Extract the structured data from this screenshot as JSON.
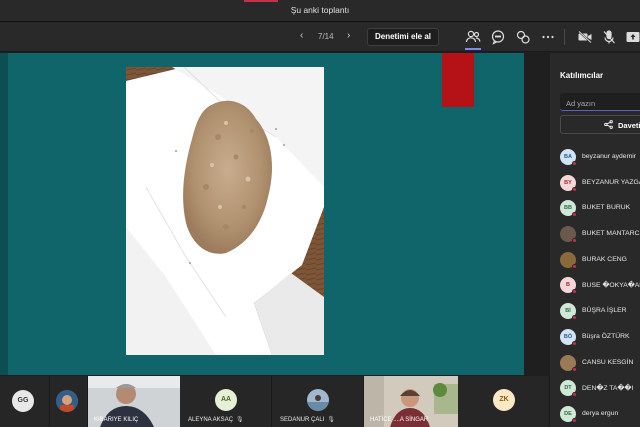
{
  "window": {
    "title": "Şu anki toplantı"
  },
  "toolbar": {
    "prev_icon": "chevron-left-icon",
    "page_indicator": "7/14",
    "next_icon": "chevron-right-icon",
    "take_control_label": "Denetimi ele al",
    "icons": [
      "participants-icon",
      "chat-icon",
      "reactions-icon",
      "more-icon",
      "camera-off-icon",
      "mic-off-icon",
      "share-icon"
    ]
  },
  "colors": {
    "stage": "#0f6569",
    "accent": "#c4314b",
    "red_block": "#b51217",
    "brand": "#5b5fc7"
  },
  "panel": {
    "title": "Katılımcılar",
    "search_placeholder": "Ad yazın",
    "invite_label": "Daveti",
    "participants": [
      {
        "initials": "BA",
        "name": "beyzanur aydemir",
        "avatar_bg": "#cfe4f5",
        "avatar_fg": "#2b5a8a"
      },
      {
        "initials": "BY",
        "name": "BEYZANUR YAZGA",
        "avatar_bg": "#f6d7d9",
        "avatar_fg": "#a4262c"
      },
      {
        "initials": "BB",
        "name": "BUKET BURUK",
        "avatar_bg": "#cfe8d8",
        "avatar_fg": "#2f6b3f"
      },
      {
        "initials": "",
        "name": "BUKET MANTARCI",
        "avatar_bg": "#6b5a4c",
        "avatar_fg": "#ffffff",
        "photo": true
      },
      {
        "initials": "",
        "name": "BURAK CENG",
        "avatar_bg": "#8a6a3a",
        "avatar_fg": "#ffffff",
        "photo": true
      },
      {
        "initials": "B",
        "name": "BUSE �OKYA�AN",
        "avatar_bg": "#f6d7d9",
        "avatar_fg": "#a4262c"
      },
      {
        "initials": "Bİ",
        "name": "BÜŞRA İŞLER",
        "avatar_bg": "#cfe8d8",
        "avatar_fg": "#2f6b3f"
      },
      {
        "initials": "BÖ",
        "name": "Büşra ÖZTÜRK",
        "avatar_bg": "#cfe4f5",
        "avatar_fg": "#2b5a8a"
      },
      {
        "initials": "",
        "name": "CANSU KESGİN",
        "avatar_bg": "#9a7a55",
        "avatar_fg": "#ffffff",
        "photo": true
      },
      {
        "initials": "DT",
        "name": "DEN�Z TA��I",
        "avatar_bg": "#cfe8d8",
        "avatar_fg": "#2f6b3f"
      },
      {
        "initials": "DE",
        "name": "derya ergun",
        "avatar_bg": "#cfe8d8",
        "avatar_fg": "#2f6b3f"
      }
    ]
  },
  "gallery": {
    "tiles": [
      {
        "initials": "GG",
        "name": ""
      },
      {
        "initials": "",
        "name": ""
      },
      {
        "initials": "",
        "name": "KIBARIYE KILIÇ"
      },
      {
        "initials": "AA",
        "name": "ALEYNA AKSAÇ"
      },
      {
        "initials": "",
        "name": "SEDANUR ÇALI"
      },
      {
        "initials": "",
        "name": "HATİCE ....A SİNGAR"
      },
      {
        "initials": "ZK",
        "name": ""
      }
    ]
  }
}
